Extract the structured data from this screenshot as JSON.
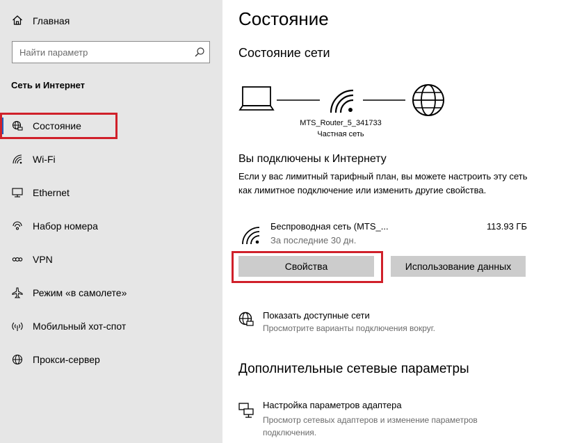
{
  "sidebar": {
    "home_label": "Главная",
    "search_placeholder": "Найти параметр",
    "section_title": "Сеть и Интернет",
    "items": [
      {
        "label": "Состояние",
        "icon": "globe-monitor-icon"
      },
      {
        "label": "Wi-Fi",
        "icon": "wifi-icon"
      },
      {
        "label": "Ethernet",
        "icon": "ethernet-monitor-icon"
      },
      {
        "label": "Набор номера",
        "icon": "dialup-icon"
      },
      {
        "label": "VPN",
        "icon": "vpn-icon"
      },
      {
        "label": "Режим «в самолете»",
        "icon": "airplane-icon"
      },
      {
        "label": "Мобильный хот-спот",
        "icon": "hotspot-icon"
      },
      {
        "label": "Прокси-сервер",
        "icon": "globe-icon"
      }
    ],
    "selected_index": 0,
    "accent_color": "#1f5fbf",
    "highlight_color": "#d0202a"
  },
  "main": {
    "title": "Состояние",
    "network_status_title": "Состояние сети",
    "network_name": "MTS_Router_5_341733",
    "network_type": "Частная сеть",
    "connected_title": "Вы подключены к Интернету",
    "connected_desc": "Если у вас лимитный тарифный план, вы можете настроить эту сеть как лимитное подключение или изменить другие свойства.",
    "connection": {
      "name": "Беспроводная сеть (MTS_...",
      "period": "За последние 30 дн.",
      "usage": "113.93 ГБ"
    },
    "buttons": {
      "properties": "Свойства",
      "data_usage": "Использование данных"
    },
    "show_networks": {
      "title": "Показать доступные сети",
      "desc": "Просмотрите варианты подключения вокруг."
    },
    "advanced_title": "Дополнительные сетевые параметры",
    "adapter_settings": {
      "title": "Настройка параметров адаптера",
      "desc": "Просмотр сетевых адаптеров и изменение параметров подключения."
    }
  }
}
